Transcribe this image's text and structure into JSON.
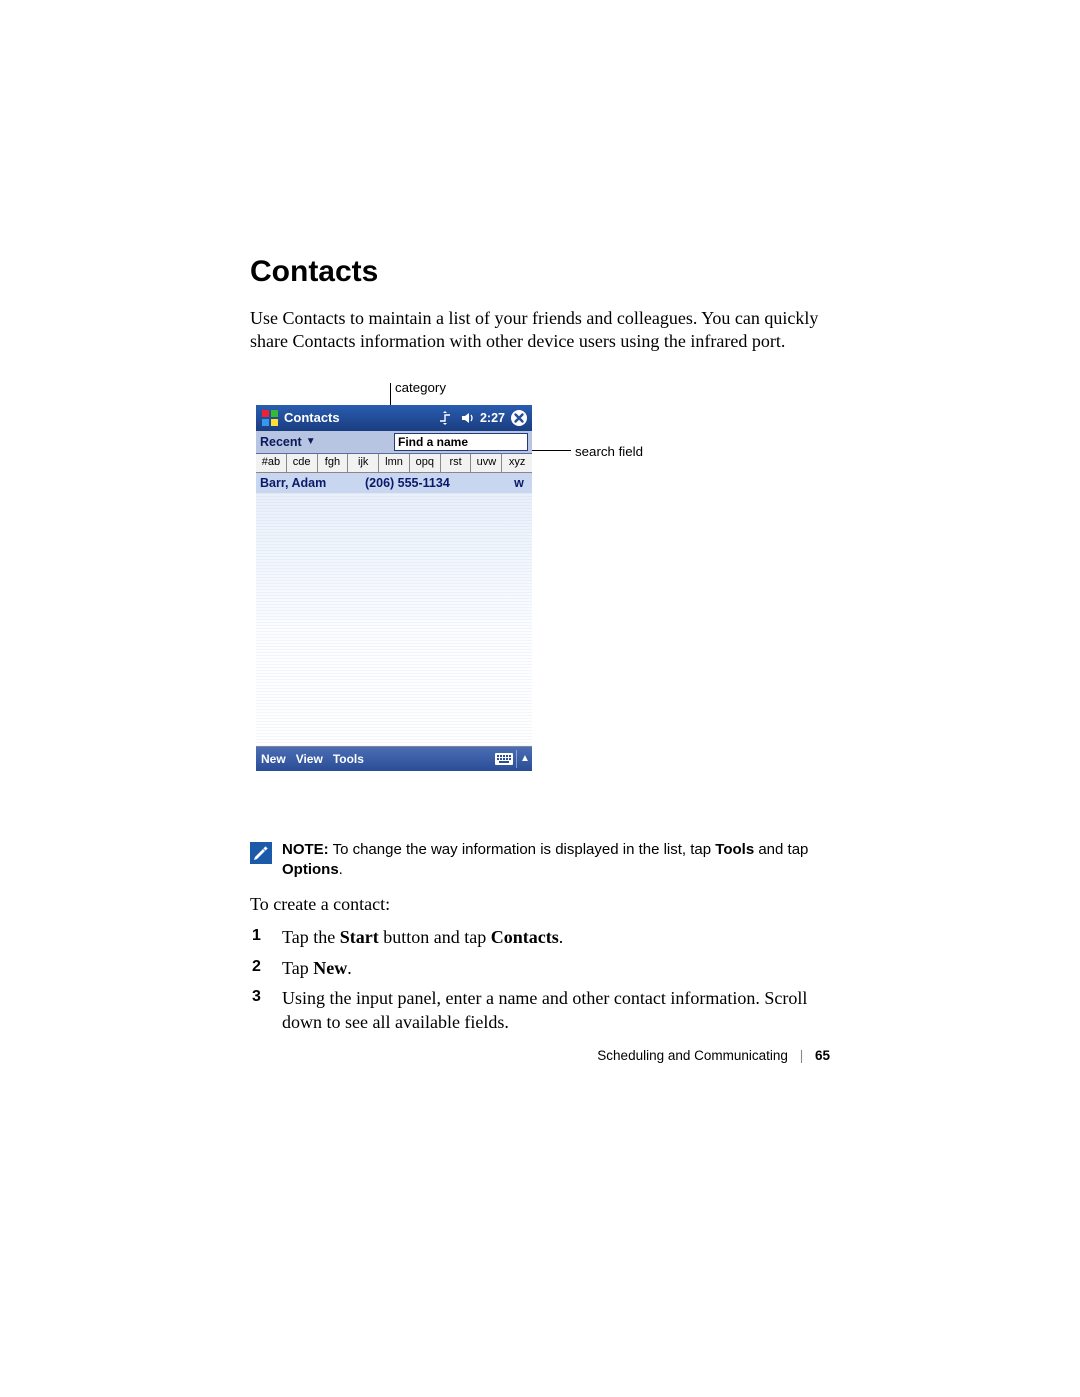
{
  "heading": "Contacts",
  "intro": "Use Contacts to maintain a list of your friends and colleagues. You can quickly share Contacts information with other device users using the infrared port.",
  "callouts": {
    "category": "category",
    "search_field": "search field"
  },
  "pda": {
    "title": "Contacts",
    "time": "2:27",
    "category_label": "Recent",
    "find_placeholder": "Find a name",
    "alpha_tabs": [
      "#ab",
      "cde",
      "fgh",
      "ijk",
      "lmn",
      "opq",
      "rst",
      "uvw",
      "xyz"
    ],
    "entry": {
      "name": "Barr, Adam",
      "phone": "(206) 555-1134",
      "indicator": "w"
    },
    "menu": {
      "new": "New",
      "view": "View",
      "tools": "Tools"
    }
  },
  "note": {
    "label": "NOTE:",
    "pre": " To change the way information is displayed in the list, tap ",
    "b1": "Tools",
    "mid": " and tap ",
    "b2": "Options",
    "post": "."
  },
  "instruction": "To create a contact:",
  "steps": {
    "s1_a": "Tap the ",
    "s1_b1": "Start",
    "s1_b": " button and tap ",
    "s1_b2": "Contacts",
    "s1_c": ".",
    "s2_a": "Tap ",
    "s2_b1": "New",
    "s2_b": ".",
    "s3": "Using the input panel, enter a name and other contact information. Scroll down to see all available fields."
  },
  "footer": {
    "section": "Scheduling and Communicating",
    "page": "65"
  }
}
